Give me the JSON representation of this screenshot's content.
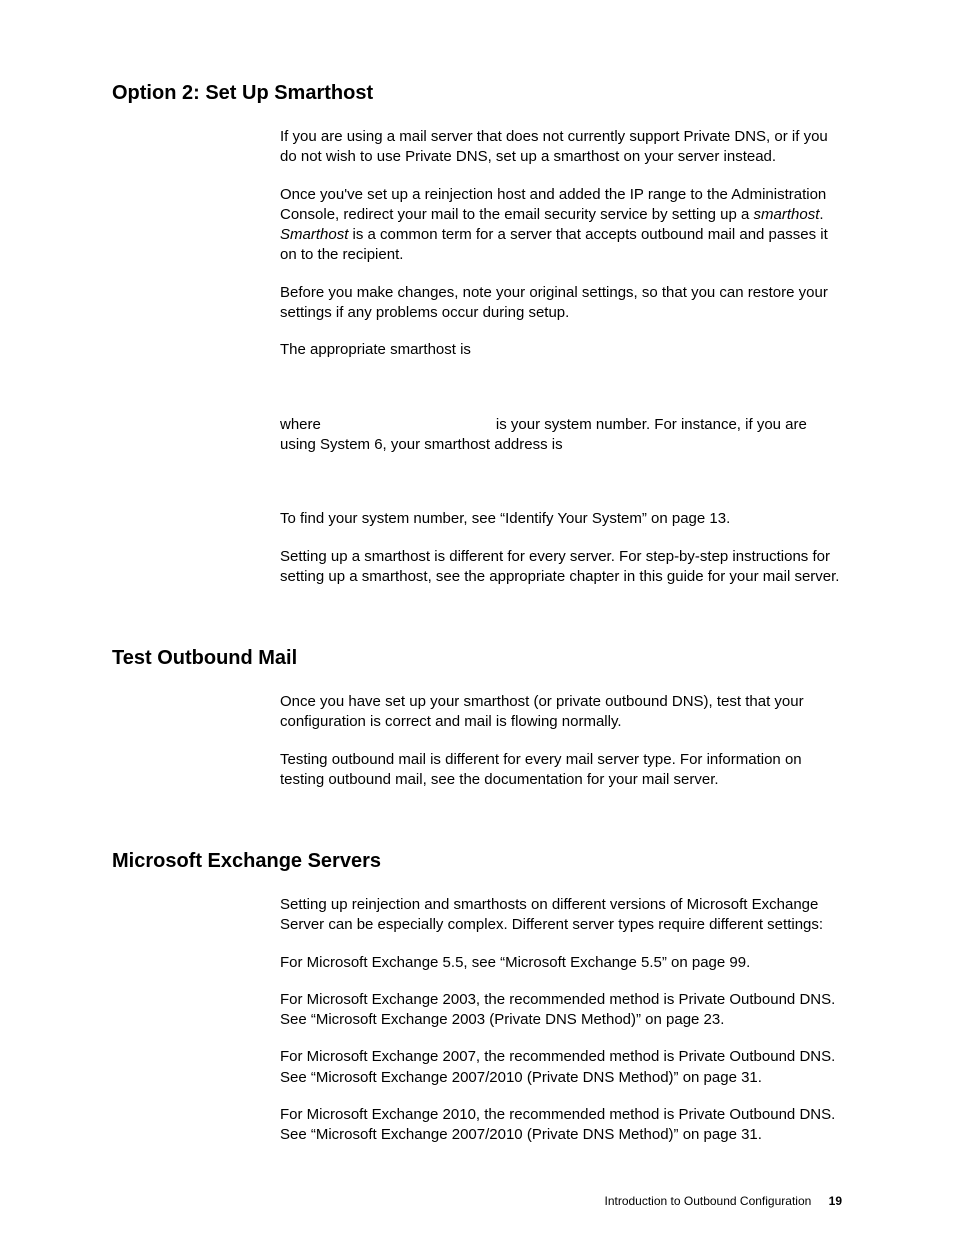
{
  "sections": [
    {
      "title": "Option 2: Set Up Smarthost",
      "paragraphs": [
        {
          "text": "If you are using a mail server that does not currently support Private DNS, or if you do not wish to use Private DNS, set up a smarthost on your server instead."
        },
        {
          "html": "Once you've set up a reinjection host and added the IP range to the Administration Console, redirect your mail to the email security service by setting up a <span class=\"italic\">smarthost</span>. <span class=\"italic\">Smarthost</span> is a common term for a server that accepts outbound mail and passes it on to the recipient."
        },
        {
          "text": "Before you make changes, note your original settings, so that you can restore your settings if any problems occur during setup."
        },
        {
          "text": "The appropriate smarthost is"
        },
        {
          "text": " ",
          "spacer": true
        },
        {
          "text": "where                                          is your system number. For instance, if you are using System 6, your smarthost address is"
        },
        {
          "text": " ",
          "spacer": true
        },
        {
          "text": "To find your system number, see “Identify Your System” on page 13."
        },
        {
          "text": "Setting up a smarthost is different for every server. For step-by-step instructions for setting up a smarthost, see the appropriate chapter in this guide for your mail server."
        }
      ]
    },
    {
      "title": "Test Outbound Mail",
      "paragraphs": [
        {
          "text": "Once you have set up your smarthost (or private outbound DNS), test that your configuration is correct and mail is flowing normally."
        },
        {
          "text": "Testing outbound mail is different for every mail server type. For information on testing outbound mail, see the documentation for your mail server."
        }
      ]
    },
    {
      "title": "Microsoft Exchange Servers",
      "paragraphs": [
        {
          "text": "Setting up reinjection and smarthosts on different versions of Microsoft Exchange Server can be especially complex. Different server types require different settings:"
        },
        {
          "text": "For Microsoft Exchange 5.5, see “Microsoft Exchange 5.5” on page 99."
        },
        {
          "text": "For Microsoft Exchange 2003, the recommended method is Private Outbound DNS. See “Microsoft Exchange 2003 (Private DNS Method)” on page 23."
        },
        {
          "text": "For Microsoft Exchange 2007, the recommended method is Private Outbound DNS. See “Microsoft Exchange 2007/2010 (Private DNS Method)” on page 31."
        },
        {
          "text": "For Microsoft Exchange 2010, the recommended method is Private Outbound DNS. See “Microsoft Exchange 2007/2010 (Private DNS Method)” on page 31."
        }
      ]
    }
  ],
  "footer": {
    "title": "Introduction to Outbound Configuration",
    "page": "19"
  }
}
